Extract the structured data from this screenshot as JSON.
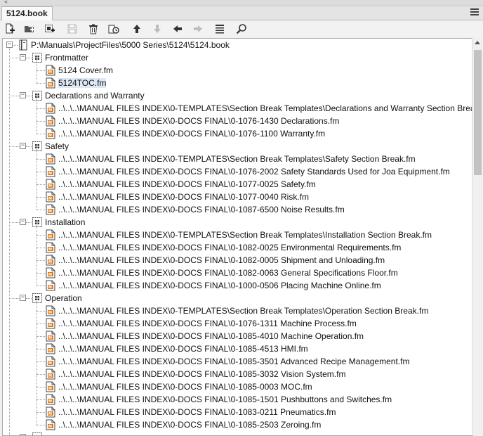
{
  "window": {
    "tab_title": "5124.book"
  },
  "toolbar": {
    "buttons": [
      {
        "name": "add-file-button",
        "icon": "add-file-icon",
        "enabled": true
      },
      {
        "name": "add-folder-button",
        "icon": "add-folder-icon",
        "enabled": true
      },
      {
        "name": "add-group-button",
        "icon": "add-group-icon",
        "enabled": true
      },
      {
        "name": "save-button",
        "icon": "save-icon",
        "enabled": false
      },
      {
        "name": "delete-button",
        "icon": "trash-icon",
        "enabled": true
      },
      {
        "name": "update-book-button",
        "icon": "update-icon",
        "enabled": true
      },
      {
        "name": "move-up-button",
        "icon": "arrow-up-icon",
        "enabled": true
      },
      {
        "name": "move-down-button",
        "icon": "arrow-down-icon",
        "enabled": false
      },
      {
        "name": "move-left-button",
        "icon": "arrow-left-icon",
        "enabled": true
      },
      {
        "name": "move-right-button",
        "icon": "arrow-right-icon",
        "enabled": false
      },
      {
        "name": "list-view-button",
        "icon": "list-icon",
        "enabled": true
      },
      {
        "name": "find-button",
        "icon": "magnifier-icon",
        "enabled": true
      }
    ]
  },
  "colors": {
    "selected_row": "#dde8f5",
    "file_icon_accent": "#e07b1a",
    "tree_line": "#9a9a9a"
  },
  "tree": {
    "root": "P:\\Manuals\\ProjectFiles\\5000 Series\\5124\\5124.book",
    "groups": [
      {
        "label": "Frontmatter",
        "items": [
          "5124 Cover.fm",
          "5124TOC.fm"
        ]
      },
      {
        "label": "Declarations and Warranty",
        "items": [
          "..\\..\\..\\MANUAL FILES INDEX\\0-TEMPLATES\\Section Break Templates\\Declarations and Warranty Section Break.fm",
          "..\\..\\..\\MANUAL FILES INDEX\\0-DOCS FINAL\\0-1076-1430 Declarations.fm",
          "..\\..\\..\\MANUAL FILES INDEX\\0-DOCS FINAL\\0-1076-1100 Warranty.fm"
        ]
      },
      {
        "label": "Safety",
        "items": [
          "..\\..\\..\\MANUAL FILES INDEX\\0-TEMPLATES\\Section Break Templates\\Safety Section Break.fm",
          "..\\..\\..\\MANUAL FILES INDEX\\0-DOCS FINAL\\0-1076-2002 Safety Standards Used for Joa Equipment.fm",
          "..\\..\\..\\MANUAL FILES INDEX\\0-DOCS FINAL\\0-1077-0025 Safety.fm",
          "..\\..\\..\\MANUAL FILES INDEX\\0-DOCS FINAL\\0-1077-0040 Risk.fm",
          "..\\..\\..\\MANUAL FILES INDEX\\0-DOCS FINAL\\0-1087-6500 Noise Results.fm"
        ]
      },
      {
        "label": "Installation",
        "items": [
          "..\\..\\..\\MANUAL FILES INDEX\\0-TEMPLATES\\Section Break Templates\\Installation Section Break.fm",
          "..\\..\\..\\MANUAL FILES INDEX\\0-DOCS FINAL\\0-1082-0025 Environmental Requirements.fm",
          "..\\..\\..\\MANUAL FILES INDEX\\0-DOCS FINAL\\0-1082-0005 Shipment and Unloading.fm",
          "..\\..\\..\\MANUAL FILES INDEX\\0-DOCS FINAL\\0-1082-0063 General Specifications Floor.fm",
          "..\\..\\..\\MANUAL FILES INDEX\\0-DOCS FINAL\\0-1000-0506 Placing Machine Online.fm"
        ]
      },
      {
        "label": "Operation",
        "items": [
          "..\\..\\..\\MANUAL FILES INDEX\\0-TEMPLATES\\Section Break Templates\\Operation Section Break.fm",
          "..\\..\\..\\MANUAL FILES INDEX\\0-DOCS FINAL\\0-1076-1311 Machine Process.fm",
          "..\\..\\..\\MANUAL FILES INDEX\\0-DOCS FINAL\\0-1085-4010 Machine Operation.fm",
          "..\\..\\..\\MANUAL FILES INDEX\\0-DOCS FINAL\\0-1085-4513 HMI.fm",
          "..\\..\\..\\MANUAL FILES INDEX\\0-DOCS FINAL\\0-1085-3501 Advanced Recipe Management.fm",
          "..\\..\\..\\MANUAL FILES INDEX\\0-DOCS FINAL\\0-1085-3032 Vision System.fm",
          "..\\..\\..\\MANUAL FILES INDEX\\0-DOCS FINAL\\0-1085-0003 MOC.fm",
          "..\\..\\..\\MANUAL FILES INDEX\\0-DOCS FINAL\\0-1085-1501 Pushbuttons and Switches.fm",
          "..\\..\\..\\MANUAL FILES INDEX\\0-DOCS FINAL\\0-1083-0211 Pneumatics.fm",
          "..\\..\\..\\MANUAL FILES INDEX\\0-DOCS FINAL\\0-1085-2503 Zeroing.fm"
        ]
      }
    ],
    "selected": {
      "group": 0,
      "item": 1
    }
  }
}
